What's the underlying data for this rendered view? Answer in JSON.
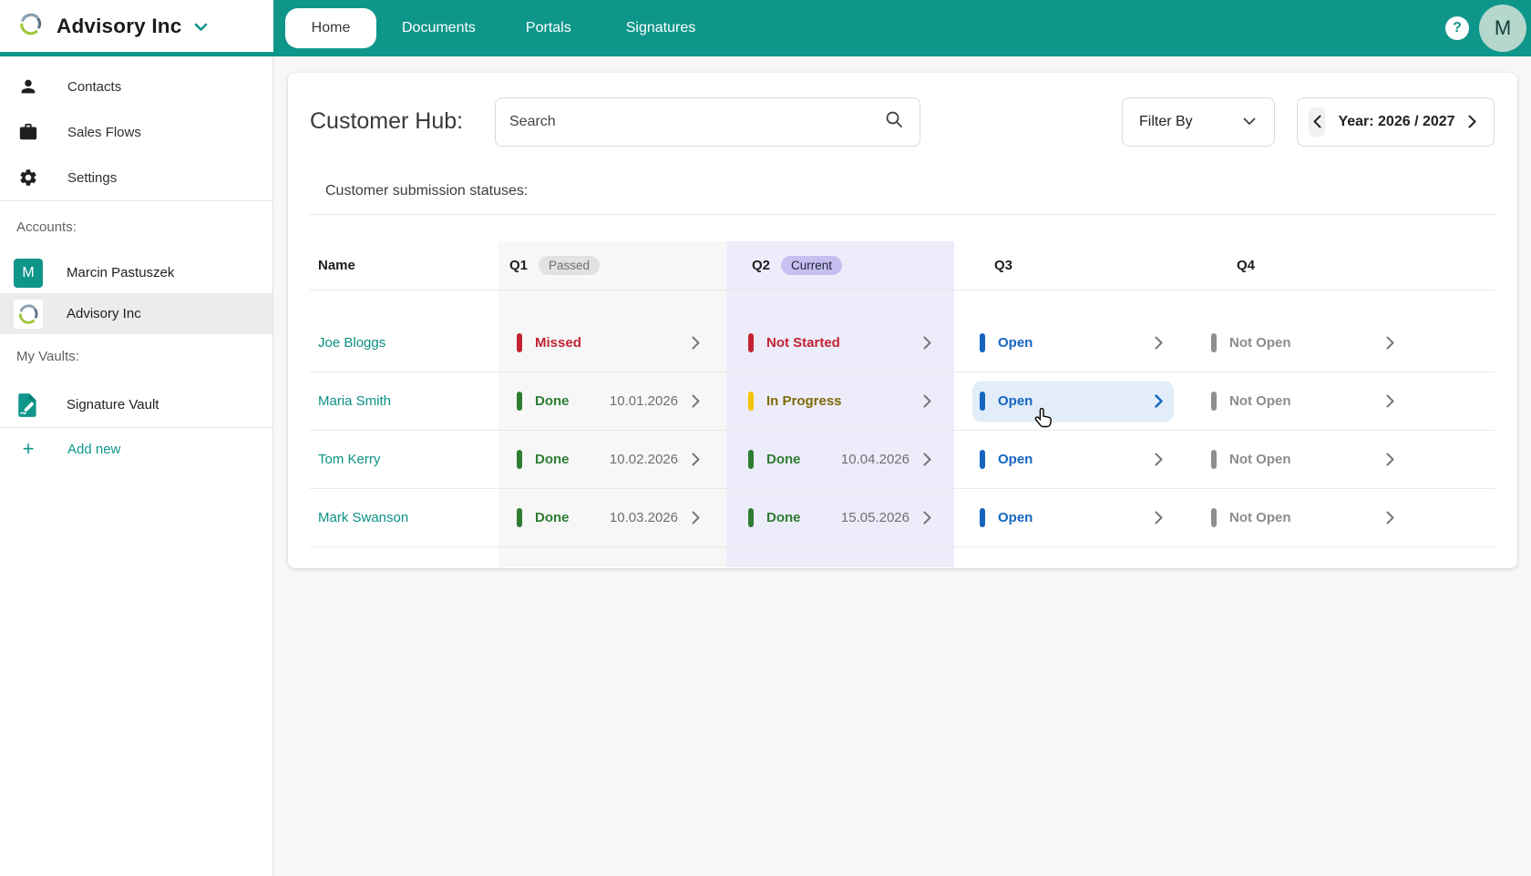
{
  "brand": {
    "name": "Advisory Inc"
  },
  "nav": {
    "tabs": [
      {
        "label": "Home",
        "active": true
      },
      {
        "label": "Documents",
        "active": false
      },
      {
        "label": "Portals",
        "active": false
      },
      {
        "label": "Signatures",
        "active": false
      }
    ],
    "help_glyph": "?",
    "avatar_initial": "M"
  },
  "sidebar": {
    "items": [
      {
        "icon": "person",
        "label": "Contacts"
      },
      {
        "icon": "briefcase",
        "label": "Sales Flows"
      },
      {
        "icon": "gear",
        "label": "Settings"
      }
    ],
    "accounts_label": "Accounts:",
    "accounts": [
      {
        "initial": "M",
        "label": "Marcin Pastuszek",
        "selected": false
      },
      {
        "logo": true,
        "label": "Advisory Inc",
        "selected": true
      }
    ],
    "vaults_label": "My Vaults:",
    "vaults": [
      {
        "label": "Signature Vault"
      }
    ],
    "add_new_label": "Add new"
  },
  "main": {
    "title": "Customer Hub:",
    "search_placeholder": "Search",
    "filter_label": "Filter By",
    "year_label": "Year: 2026 / 2027",
    "section_label": "Customer submission statuses:",
    "table": {
      "columns": [
        {
          "label": "Name",
          "badge": null
        },
        {
          "label": "Q1",
          "badge": "Passed"
        },
        {
          "label": "Q2",
          "badge": "Current"
        },
        {
          "label": "Q3",
          "badge": null
        },
        {
          "label": "Q4",
          "badge": null
        }
      ],
      "rows": [
        {
          "name": "Joe Bloggs",
          "q1": {
            "status": "Missed",
            "color": "red",
            "date": null
          },
          "q2": {
            "status": "Not Started",
            "color": "red",
            "date": null
          },
          "q3": {
            "status": "Open",
            "color": "blue",
            "date": null,
            "hover": false
          },
          "q4": {
            "status": "Not Open",
            "color": "gray",
            "date": null
          }
        },
        {
          "name": "Maria Smith",
          "q1": {
            "status": "Done",
            "color": "green",
            "date": "10.01.2026"
          },
          "q2": {
            "status": "In Progress",
            "color": "yellow",
            "date": null
          },
          "q3": {
            "status": "Open",
            "color": "blue",
            "date": null,
            "hover": true
          },
          "q4": {
            "status": "Not Open",
            "color": "gray",
            "date": null
          }
        },
        {
          "name": "Tom Kerry",
          "q1": {
            "status": "Done",
            "color": "green",
            "date": "10.02.2026"
          },
          "q2": {
            "status": "Done",
            "color": "green",
            "date": "10.04.2026"
          },
          "q3": {
            "status": "Open",
            "color": "blue",
            "date": null,
            "hover": false
          },
          "q4": {
            "status": "Not Open",
            "color": "gray",
            "date": null
          }
        },
        {
          "name": "Mark Swanson",
          "q1": {
            "status": "Done",
            "color": "green",
            "date": "10.03.2026"
          },
          "q2": {
            "status": "Done",
            "color": "green",
            "date": "15.05.2026"
          },
          "q3": {
            "status": "Open",
            "color": "blue",
            "date": null,
            "hover": false
          },
          "q4": {
            "status": "Not Open",
            "color": "gray",
            "date": null
          }
        }
      ]
    },
    "palette": {
      "red": {
        "bar": "#C32332",
        "text": "#C32332"
      },
      "green": {
        "bar": "#2E7D32",
        "text": "#2E7D32"
      },
      "yellow": {
        "bar": "#F2C400",
        "text": "#7D6A08"
      },
      "blue": {
        "bar": "#1565C0",
        "text": "#1565C0"
      },
      "gray": {
        "bar": "#8F8F8F",
        "text": "#8C8C8C"
      }
    },
    "accent": "#0F968A",
    "q1_band": "#F7F7F7",
    "q2_band": "#EDECFB",
    "hover_cell": "#E2EDF9"
  }
}
